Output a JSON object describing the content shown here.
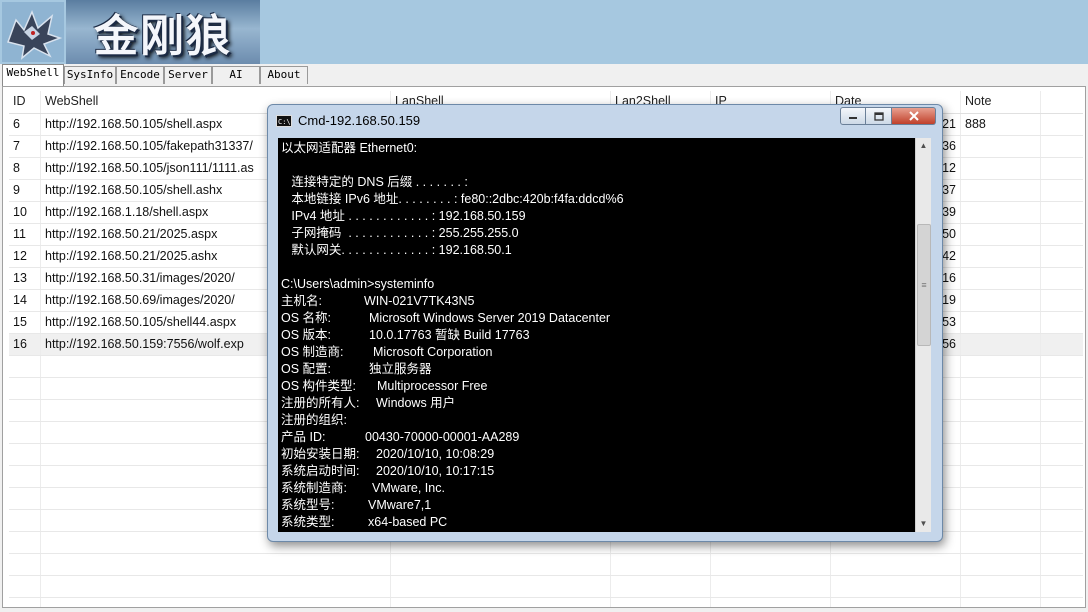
{
  "app": {
    "logo_text": "金刚狼"
  },
  "tabs": [
    {
      "label": "WebShell",
      "active": true
    },
    {
      "label": "SysInfo"
    },
    {
      "label": "Encode"
    },
    {
      "label": "Server"
    },
    {
      "label": "AI"
    },
    {
      "label": "About"
    }
  ],
  "grid": {
    "columns": [
      "ID",
      "WebShell",
      "LanShell",
      "Lan2Shell",
      "IP",
      "Date",
      "Note"
    ],
    "rows": [
      {
        "id": "6",
        "webshell": "http://192.168.50.105/shell.aspx",
        "date_tail": "21",
        "note": "888"
      },
      {
        "id": "7",
        "webshell": "http://192.168.50.105/fakepath31337/",
        "date_tail": "36",
        "note": ""
      },
      {
        "id": "8",
        "webshell": "http://192.168.50.105/json111/1111.as",
        "date_tail": "12",
        "note": ""
      },
      {
        "id": "9",
        "webshell": "http://192.168.50.105/shell.ashx",
        "date_tail": "37",
        "note": ""
      },
      {
        "id": "10",
        "webshell": "http://192.168.1.18/shell.aspx",
        "date_tail": "39",
        "note": ""
      },
      {
        "id": "11",
        "webshell": "http://192.168.50.21/2025.aspx",
        "date_tail": "50",
        "note": ""
      },
      {
        "id": "12",
        "webshell": "http://192.168.50.21/2025.ashx",
        "date_tail": "42",
        "note": ""
      },
      {
        "id": "13",
        "webshell": "http://192.168.50.31/images/2020/",
        "date_tail": "16",
        "note": ""
      },
      {
        "id": "14",
        "webshell": "http://192.168.50.69/images/2020/",
        "date_tail": "19",
        "note": ""
      },
      {
        "id": "15",
        "webshell": "http://192.168.50.105/shell44.aspx",
        "date_tail": "53",
        "note": ""
      },
      {
        "id": "16",
        "webshell": "http://192.168.50.159:7556/wolf.exp",
        "date_tail": "56",
        "note": "",
        "selected": true
      }
    ]
  },
  "cmd": {
    "title": "Cmd-192.168.50.159",
    "icon_text": "C:\\",
    "lines": [
      {
        "k": "以太网适配器 Ethernet0:",
        "v": ""
      },
      {
        "k": "",
        "v": ""
      },
      {
        "k": "   连接特定的 DNS 后缀 . . . . . . . :",
        "v": ""
      },
      {
        "k": "   本地链接 IPv6 地址. . . . . . . . : fe80::2dbc:420b:f4fa:ddcd%6",
        "v": ""
      },
      {
        "k": "   IPv4 地址 . . . . . . . . . . . . : 192.168.50.159",
        "v": ""
      },
      {
        "k": "   子网掩码  . . . . . . . . . . . . : 255.255.255.0",
        "v": ""
      },
      {
        "k": "   默认网关. . . . . . . . . . . . . : 192.168.50.1",
        "v": ""
      },
      {
        "k": "",
        "v": ""
      },
      {
        "k": "C:\\Users\\admin>systeminfo",
        "v": ""
      },
      {
        "k": "主机名:",
        "v": "WIN-021V7TK43N5"
      },
      {
        "k": "OS 名称:",
        "v": "Microsoft Windows Server 2019 Datacenter"
      },
      {
        "k": "OS 版本:",
        "v": "10.0.17763 暂缺 Build 17763"
      },
      {
        "k": "OS 制造商:",
        "v": "Microsoft Corporation"
      },
      {
        "k": "OS 配置:",
        "v": "独立服务器"
      },
      {
        "k": "OS 构件类型:",
        "v": "Multiprocessor Free"
      },
      {
        "k": "注册的所有人:",
        "v": "Windows 用户"
      },
      {
        "k": "注册的组织:",
        "v": ""
      },
      {
        "k": "产品 ID:",
        "v": "00430-70000-00001-AA289"
      },
      {
        "k": "初始安装日期:",
        "v": "2020/10/10, 10:08:29"
      },
      {
        "k": "系统启动时间:",
        "v": "2020/10/10, 10:17:15"
      },
      {
        "k": "系统制造商:",
        "v": "VMware, Inc."
      },
      {
        "k": "系统型号:",
        "v": "VMware7,1"
      },
      {
        "k": "系统类型:",
        "v": "x64-based PC"
      }
    ]
  }
}
